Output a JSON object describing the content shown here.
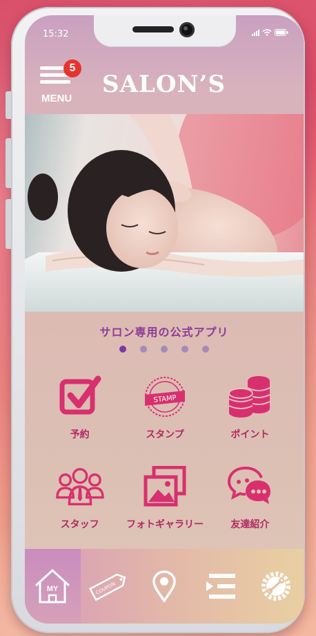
{
  "status_bar": {
    "time": "15:32"
  },
  "header": {
    "menu_label": "MENU",
    "menu_badge": "5",
    "title": "SALON’S"
  },
  "carousel": {
    "caption": "サロン専用の公式アプリ",
    "active_index": 0,
    "slide_count": 5
  },
  "features": [
    {
      "label": "予約",
      "icon": "calendar-check-icon"
    },
    {
      "label": "スタンプ",
      "icon": "stamp-icon",
      "badge_text": "STAMP"
    },
    {
      "label": "ポイント",
      "icon": "coins-icon"
    },
    {
      "label": "スタッフ",
      "icon": "staff-group-icon"
    },
    {
      "label": "フォトギャラリー",
      "icon": "photo-gallery-icon"
    },
    {
      "label": "友達紹介",
      "icon": "chat-bubbles-icon"
    }
  ],
  "tabbar": {
    "items": [
      {
        "icon": "home-icon",
        "label": "MY",
        "active": true
      },
      {
        "icon": "coupon-icon",
        "label": "COUPON"
      },
      {
        "icon": "location-pin-icon"
      },
      {
        "icon": "list-menu-icon"
      },
      {
        "icon": "settings-gear-icon"
      }
    ]
  },
  "colors": {
    "accent_pink": "#d8306e",
    "caption_purple": "#8e3a96",
    "badge_red": "#e8332d"
  }
}
